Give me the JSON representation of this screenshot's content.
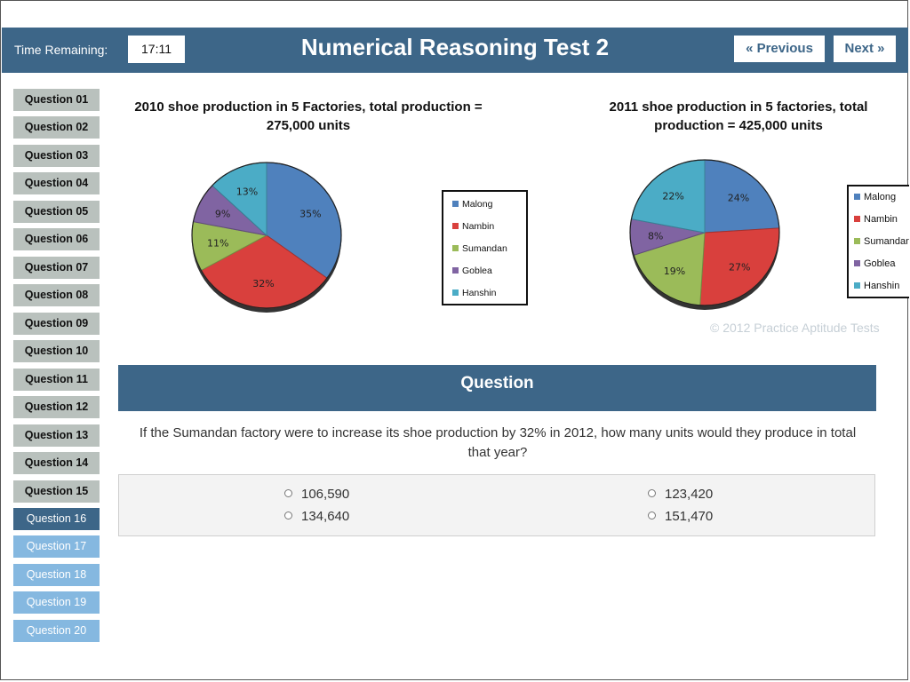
{
  "header": {
    "time_label": "Time Remaining:",
    "time_value": "17:11",
    "title": "Numerical Reasoning Test 2",
    "prev_label": "« Previous",
    "next_label": "Next »"
  },
  "sidebar": {
    "items": [
      {
        "label": "Question 01",
        "state": "done"
      },
      {
        "label": "Question 02",
        "state": "done"
      },
      {
        "label": "Question 03",
        "state": "done"
      },
      {
        "label": "Question 04",
        "state": "done"
      },
      {
        "label": "Question 05",
        "state": "done"
      },
      {
        "label": "Question 06",
        "state": "done"
      },
      {
        "label": "Question 07",
        "state": "done"
      },
      {
        "label": "Question 08",
        "state": "done"
      },
      {
        "label": "Question 09",
        "state": "done"
      },
      {
        "label": "Question 10",
        "state": "done"
      },
      {
        "label": "Question 11",
        "state": "done"
      },
      {
        "label": "Question 12",
        "state": "done"
      },
      {
        "label": "Question 13",
        "state": "done"
      },
      {
        "label": "Question 14",
        "state": "done"
      },
      {
        "label": "Question 15",
        "state": "done"
      },
      {
        "label": "Question 16",
        "state": "current"
      },
      {
        "label": "Question 17",
        "state": "todo"
      },
      {
        "label": "Question 18",
        "state": "todo"
      },
      {
        "label": "Question 19",
        "state": "todo"
      },
      {
        "label": "Question 20",
        "state": "todo"
      }
    ]
  },
  "chart_data": [
    {
      "type": "pie",
      "title": "2010 shoe production in 5 Factories, total production = 275,000 units",
      "categories": [
        "Malong",
        "Nambin",
        "Sumandan",
        "Goblea",
        "Hanshin"
      ],
      "values": [
        35,
        32,
        11,
        9,
        13
      ],
      "labels": [
        "35%",
        "32%",
        "11%",
        "9%",
        "13%"
      ],
      "legend": "right"
    },
    {
      "type": "pie",
      "title": "2011 shoe production in 5 factories, total production = 425,000 units",
      "categories": [
        "Malong",
        "Nambin",
        "Sumandan",
        "Goblea",
        "Hanshin"
      ],
      "values": [
        24,
        27,
        19,
        8,
        22
      ],
      "labels": [
        "24%",
        "27%",
        "19%",
        "8%",
        "22%"
      ],
      "legend": "right"
    }
  ],
  "colors": {
    "Malong": "#4f81bd",
    "Nambin": "#d9403d",
    "Sumandan": "#9bbb59",
    "Goblea": "#8064a2",
    "Hanshin": "#4bacc6",
    "header": "#3d6688"
  },
  "copyright": "© 2012 Practice Aptitude Tests",
  "question": {
    "heading": "Question",
    "text": "If the Sumandan factory were to increase its shoe production by 32% in 2012, how many units would they produce in total that year?",
    "answers": [
      "106,590",
      "123,420",
      "134,640",
      "151,470"
    ]
  }
}
